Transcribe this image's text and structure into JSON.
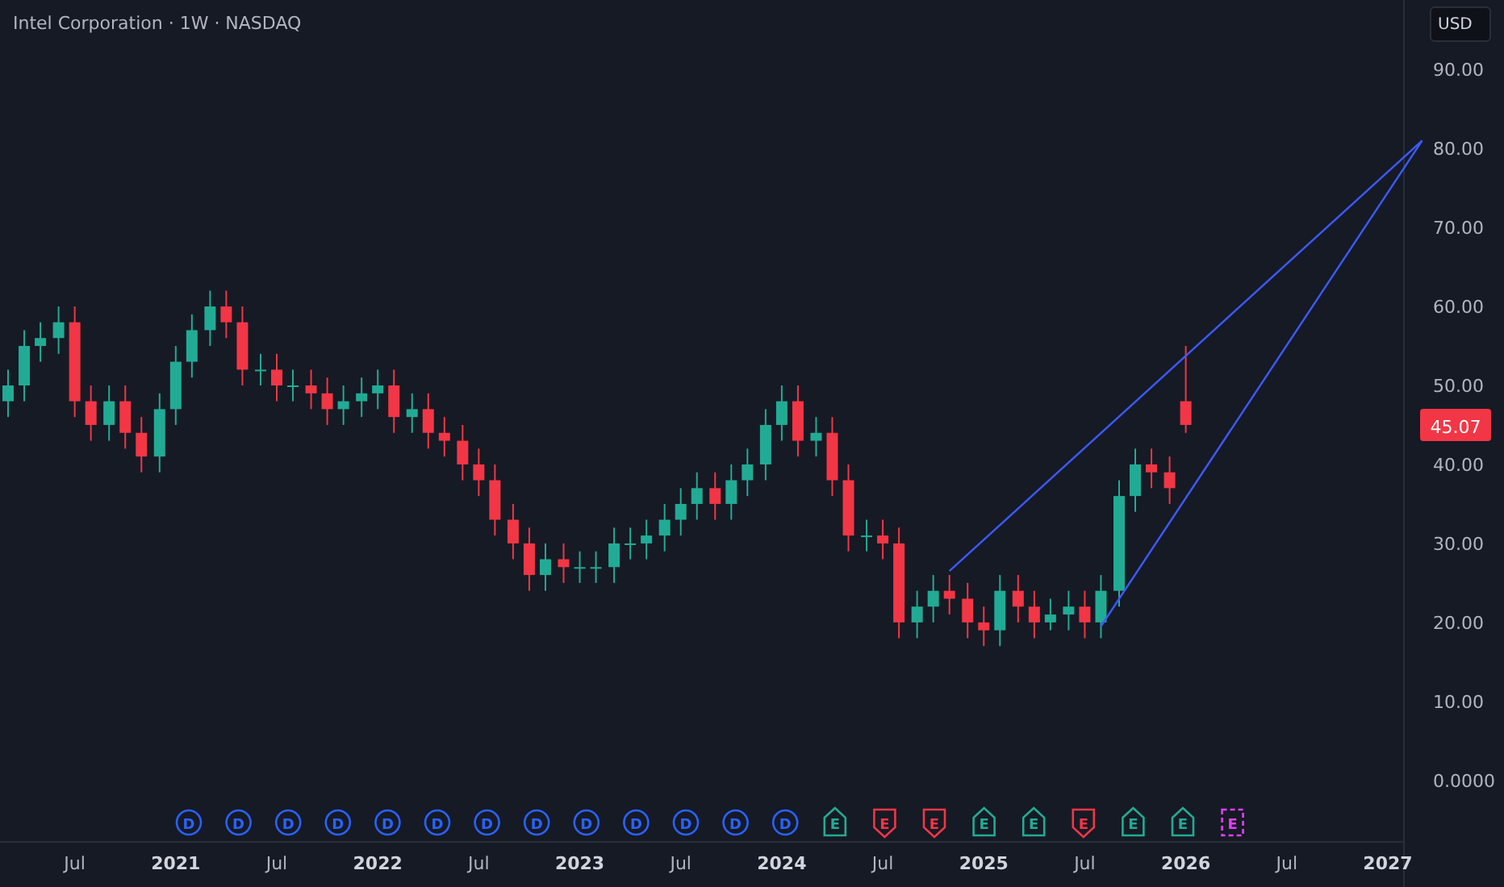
{
  "header": {
    "title": "Intel Corporation · 1W · NASDAQ"
  },
  "currency_button": {
    "label": "USD"
  },
  "chart": {
    "last_price": {
      "label": "45.07",
      "color": "#f23645"
    },
    "chart_data": {
      "type": "candlestick",
      "x": [
        2020.17,
        2020.25,
        2020.33,
        2020.42,
        2020.5,
        2020.58,
        2020.67,
        2020.75,
        2020.83,
        2020.92,
        2021,
        2021.08,
        2021.17,
        2021.25,
        2021.33,
        2021.42,
        2021.5,
        2021.58,
        2021.67,
        2021.75,
        2021.83,
        2021.92,
        2022,
        2022.08,
        2022.17,
        2022.25,
        2022.33,
        2022.42,
        2022.5,
        2022.58,
        2022.67,
        2022.75,
        2022.83,
        2022.92,
        2023,
        2023.08,
        2023.17,
        2023.25,
        2023.33,
        2023.42,
        2023.5,
        2023.58,
        2023.67,
        2023.75,
        2023.83,
        2023.92,
        2024,
        2024.08,
        2024.17,
        2024.25,
        2024.33,
        2024.42,
        2024.5,
        2024.58,
        2024.67,
        2024.75,
        2024.83,
        2024.92,
        2025,
        2025.08,
        2025.17,
        2025.25,
        2025.33,
        2025.42,
        2025.5,
        2025.58,
        2025.67,
        2025.75,
        2025.83,
        2025.92,
        2026
      ],
      "ohlc": [
        [
          48,
          52,
          46,
          50
        ],
        [
          50,
          57,
          48,
          55
        ],
        [
          55,
          58,
          53,
          56
        ],
        [
          56,
          60,
          54,
          58
        ],
        [
          58,
          60,
          46,
          48
        ],
        [
          48,
          50,
          43,
          45
        ],
        [
          45,
          50,
          43,
          48
        ],
        [
          48,
          50,
          42,
          44
        ],
        [
          44,
          46,
          39,
          41
        ],
        [
          41,
          49,
          39,
          47
        ],
        [
          47,
          55,
          45,
          53
        ],
        [
          53,
          59,
          51,
          57
        ],
        [
          57,
          62,
          55,
          60
        ],
        [
          60,
          62,
          56,
          58
        ],
        [
          58,
          60,
          50,
          52
        ],
        [
          52,
          54,
          50,
          52
        ],
        [
          52,
          54,
          48,
          50
        ],
        [
          50,
          52,
          48,
          50
        ],
        [
          50,
          52,
          47,
          49
        ],
        [
          49,
          51,
          45,
          47
        ],
        [
          47,
          50,
          45,
          48
        ],
        [
          48,
          51,
          46,
          49
        ],
        [
          49,
          52,
          47,
          50
        ],
        [
          50,
          52,
          44,
          46
        ],
        [
          46,
          49,
          44,
          47
        ],
        [
          47,
          49,
          42,
          44
        ],
        [
          44,
          46,
          41,
          43
        ],
        [
          43,
          45,
          38,
          40
        ],
        [
          40,
          42,
          36,
          38
        ],
        [
          38,
          40,
          31,
          33
        ],
        [
          33,
          35,
          28,
          30
        ],
        [
          30,
          32,
          24,
          26
        ],
        [
          26,
          30,
          24,
          28
        ],
        [
          28,
          30,
          25,
          27
        ],
        [
          27,
          29,
          25,
          27
        ],
        [
          27,
          29,
          25,
          27
        ],
        [
          27,
          32,
          25,
          30
        ],
        [
          30,
          32,
          28,
          30
        ],
        [
          30,
          33,
          28,
          31
        ],
        [
          31,
          35,
          29,
          33
        ],
        [
          33,
          37,
          31,
          35
        ],
        [
          35,
          39,
          33,
          37
        ],
        [
          37,
          39,
          33,
          35
        ],
        [
          35,
          40,
          33,
          38
        ],
        [
          38,
          42,
          36,
          40
        ],
        [
          40,
          47,
          38,
          45
        ],
        [
          45,
          50,
          43,
          48
        ],
        [
          48,
          50,
          41,
          43
        ],
        [
          43,
          46,
          41,
          44
        ],
        [
          44,
          46,
          36,
          38
        ],
        [
          38,
          40,
          29,
          31
        ],
        [
          31,
          33,
          29,
          31
        ],
        [
          31,
          33,
          28,
          30
        ],
        [
          30,
          32,
          18,
          20
        ],
        [
          20,
          24,
          18,
          22
        ],
        [
          22,
          26,
          20,
          24
        ],
        [
          24,
          26,
          21,
          23
        ],
        [
          23,
          25,
          18,
          20
        ],
        [
          20,
          22,
          17,
          19
        ],
        [
          19,
          26,
          17,
          24
        ],
        [
          24,
          26,
          20,
          22
        ],
        [
          22,
          24,
          18,
          20
        ],
        [
          20,
          23,
          19,
          21
        ],
        [
          21,
          24,
          19,
          22
        ],
        [
          22,
          24,
          18,
          20
        ],
        [
          20,
          26,
          18,
          24
        ],
        [
          24,
          38,
          22,
          36
        ],
        [
          36,
          42,
          34,
          40
        ],
        [
          40,
          42,
          37,
          39
        ],
        [
          39,
          41,
          35,
          37
        ],
        [
          48,
          55,
          44,
          45
        ]
      ],
      "xlim": [
        2020.13,
        2027.08
      ],
      "ylim": [
        -13.5,
        98.8
      ],
      "yticks": [
        {
          "value": 0,
          "label": "0.0000"
        },
        {
          "value": 10,
          "label": "10.00"
        },
        {
          "value": 20,
          "label": "20.00"
        },
        {
          "value": 30,
          "label": "30.00"
        },
        {
          "value": 40,
          "label": "40.00"
        },
        {
          "value": 50,
          "label": "50.00"
        },
        {
          "value": 60,
          "label": "60.00"
        },
        {
          "value": 70,
          "label": "70.00"
        },
        {
          "value": 80,
          "label": "80.00"
        },
        {
          "value": 90,
          "label": "90.00"
        }
      ],
      "xticks": [
        {
          "value": 2020.5,
          "label": "Jul"
        },
        {
          "value": 2021,
          "label": "2021"
        },
        {
          "value": 2021.5,
          "label": "Jul"
        },
        {
          "value": 2022,
          "label": "2022"
        },
        {
          "value": 2022.5,
          "label": "Jul"
        },
        {
          "value": 2023,
          "label": "2023"
        },
        {
          "value": 2023.5,
          "label": "Jul"
        },
        {
          "value": 2024,
          "label": "2024"
        },
        {
          "value": 2024.5,
          "label": "Jul"
        },
        {
          "value": 2025,
          "label": "2025"
        },
        {
          "value": 2025.5,
          "label": "Jul"
        },
        {
          "value": 2026,
          "label": "2026"
        },
        {
          "value": 2026.5,
          "label": "Jul"
        },
        {
          "value": 2027,
          "label": "2027"
        }
      ]
    },
    "drawings": [
      {
        "kind": "trend_line"
      },
      {
        "kind": "trend_line"
      }
    ],
    "events": [
      {
        "kind": "dividend",
        "label": "D",
        "color": "#2962ff"
      },
      {
        "kind": "dividend",
        "label": "D",
        "color": "#2962ff"
      },
      {
        "kind": "dividend",
        "label": "D",
        "color": "#2962ff"
      },
      {
        "kind": "dividend",
        "label": "D",
        "color": "#2962ff"
      },
      {
        "kind": "dividend",
        "label": "D",
        "color": "#2962ff"
      },
      {
        "kind": "dividend",
        "label": "D",
        "color": "#2962ff"
      },
      {
        "kind": "dividend",
        "label": "D",
        "color": "#2962ff"
      },
      {
        "kind": "dividend",
        "label": "D",
        "color": "#2962ff"
      },
      {
        "kind": "dividend",
        "label": "D",
        "color": "#2962ff"
      },
      {
        "kind": "dividend",
        "label": "D",
        "color": "#2962ff"
      },
      {
        "kind": "dividend",
        "label": "D",
        "color": "#2962ff"
      },
      {
        "kind": "dividend",
        "label": "D",
        "color": "#2962ff"
      },
      {
        "kind": "dividend",
        "label": "D",
        "color": "#2962ff"
      },
      {
        "kind": "earnings_beat",
        "label": "E",
        "color": "#22ab94"
      },
      {
        "kind": "earnings_miss",
        "label": "E",
        "color": "#f23645"
      },
      {
        "kind": "earnings_miss",
        "label": "E",
        "color": "#f23645"
      },
      {
        "kind": "earnings_beat",
        "label": "E",
        "color": "#22ab94"
      },
      {
        "kind": "earnings_beat",
        "label": "E",
        "color": "#22ab94"
      },
      {
        "kind": "earnings_miss",
        "label": "E",
        "color": "#f23645"
      },
      {
        "kind": "earnings_beat",
        "label": "E",
        "color": "#22ab94"
      },
      {
        "kind": "earnings_beat",
        "label": "E",
        "color": "#22ab94"
      },
      {
        "kind": "earnings_upcoming",
        "label": "E",
        "color": "#e040fb"
      }
    ]
  }
}
